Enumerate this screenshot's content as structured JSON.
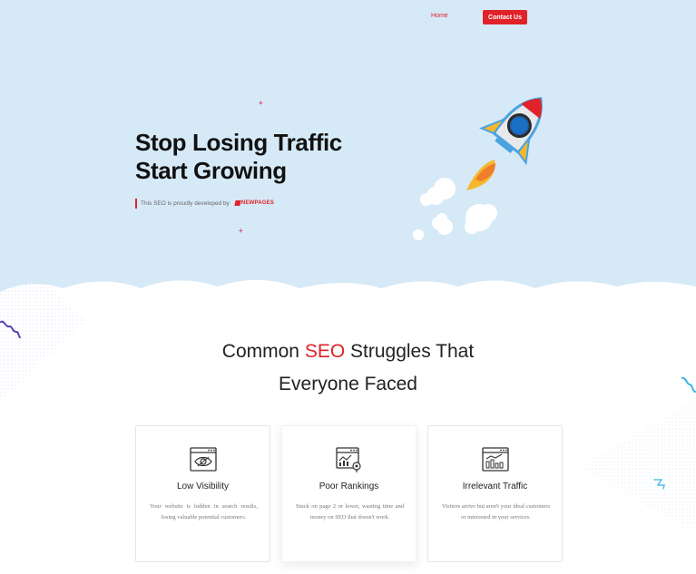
{
  "nav": {
    "home_label": "Home",
    "contact_label": "Contact Us"
  },
  "hero": {
    "title_line1": "Stop Losing Traffic",
    "title_line2": "Start Growing",
    "developed_by": "This SEO is proudly developed by",
    "brand_logo_text": "NEWPAGES"
  },
  "struggles": {
    "title_part1": "Common ",
    "title_accent": "SEO",
    "title_part2": " Struggles That",
    "title_line2": "Everyone Faced",
    "cards": [
      {
        "title": "Low Visibility",
        "text": "Your website is hidden in search results, losing valuable potential customers.",
        "icon": "eye-browser-icon"
      },
      {
        "title": "Poor Rankings",
        "text": "Stuck on page 2 or lower, wasting time and money on SEO that doesn't work.",
        "icon": "chart-browser-icon"
      },
      {
        "title": "Irrelevant Traffic",
        "text": "Visitors arrive but aren't your ideal customers or interested in your services.",
        "icon": "bar-chart-browser-icon"
      }
    ]
  },
  "colors": {
    "accent": "#e0232a",
    "hero_bg": "#d6e9f7",
    "text_dark": "#222222"
  }
}
